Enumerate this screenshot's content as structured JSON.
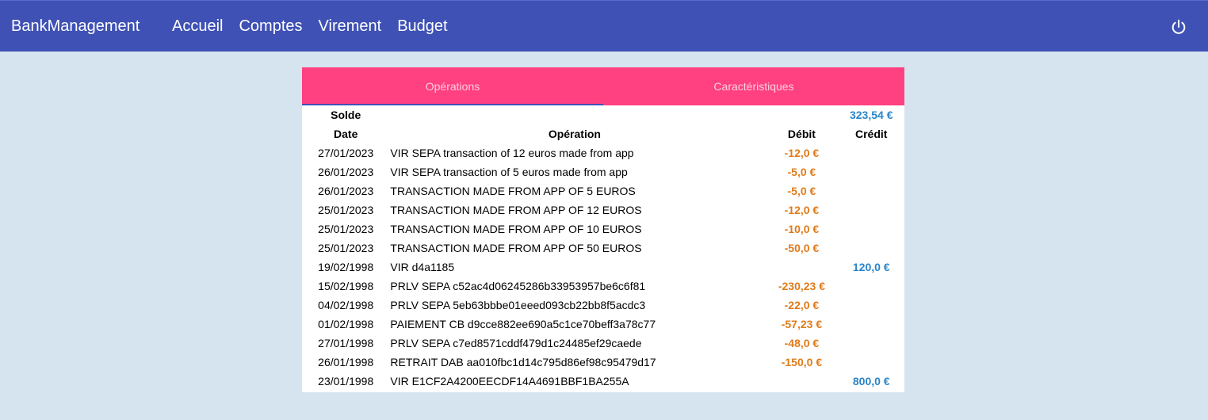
{
  "app": {
    "brand": "BankManagement",
    "nav": [
      "Accueil",
      "Comptes",
      "Virement",
      "Budget"
    ]
  },
  "colors": {
    "primary": "#3f51b5",
    "accent": "#ff4081",
    "debit": "#e07b1b",
    "credit": "#2b85c9"
  },
  "tabs": [
    {
      "label": "Opérations",
      "active": true
    },
    {
      "label": "Caractéristiques",
      "active": false
    }
  ],
  "operations": {
    "balance_label": "Solde",
    "balance_value": "323,54 €",
    "columns": [
      "Date",
      "Opération",
      "Débit",
      "Crédit"
    ],
    "rows": [
      {
        "date": "27/01/2023",
        "label": "VIR SEPA transaction of 12 euros made from app",
        "debit": "-12,0 €",
        "credit": ""
      },
      {
        "date": "26/01/2023",
        "label": "VIR SEPA transaction of 5 euros made from app",
        "debit": "-5,0 €",
        "credit": ""
      },
      {
        "date": "26/01/2023",
        "label": "TRANSACTION MADE FROM APP OF 5 EUROS",
        "debit": "-5,0 €",
        "credit": ""
      },
      {
        "date": "25/01/2023",
        "label": "TRANSACTION MADE FROM APP OF 12 EUROS",
        "debit": "-12,0 €",
        "credit": ""
      },
      {
        "date": "25/01/2023",
        "label": "TRANSACTION MADE FROM APP OF 10 EUROS",
        "debit": "-10,0 €",
        "credit": ""
      },
      {
        "date": "25/01/2023",
        "label": "TRANSACTION MADE FROM APP OF 50 EUROS",
        "debit": "-50,0 €",
        "credit": ""
      },
      {
        "date": "19/02/1998",
        "label": "VIR d4a1185",
        "debit": "",
        "credit": "120,0 €"
      },
      {
        "date": "15/02/1998",
        "label": "PRLV SEPA c52ac4d06245286b33953957be6c6f81",
        "debit": "-230,23 €",
        "credit": ""
      },
      {
        "date": "04/02/1998",
        "label": "PRLV SEPA 5eb63bbbe01eeed093cb22bb8f5acdc3",
        "debit": "-22,0 €",
        "credit": ""
      },
      {
        "date": "01/02/1998",
        "label": "PAIEMENT CB d9cce882ee690a5c1ce70beff3a78c77",
        "debit": "-57,23 €",
        "credit": ""
      },
      {
        "date": "27/01/1998",
        "label": "PRLV SEPA c7ed8571cddf479d1c24485ef29caede",
        "debit": "-48,0 €",
        "credit": ""
      },
      {
        "date": "26/01/1998",
        "label": "RETRAIT DAB aa010fbc1d14c795d86ef98c95479d17",
        "debit": "-150,0 €",
        "credit": ""
      },
      {
        "date": "23/01/1998",
        "label": "VIR E1CF2A4200EECDF14A4691BBF1BA255A",
        "debit": "",
        "credit": "800,0 €"
      }
    ]
  },
  "icons": {
    "logout": "power-icon"
  }
}
